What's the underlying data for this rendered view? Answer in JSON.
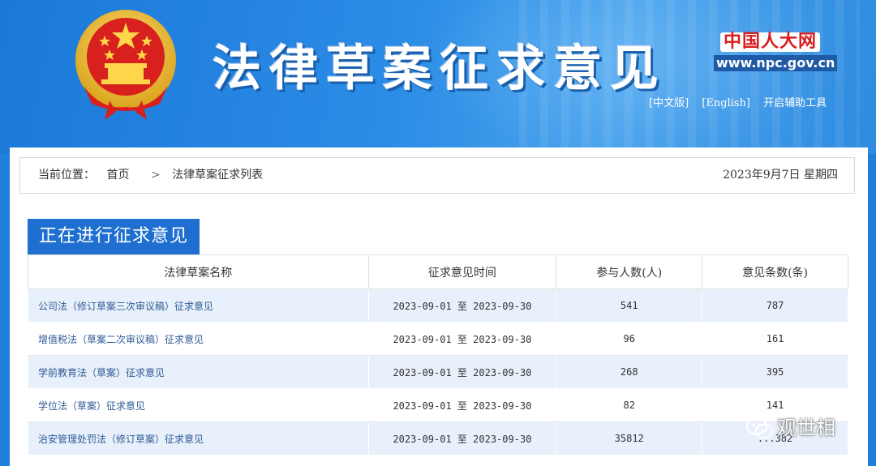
{
  "header": {
    "site_title": "法律草案征求意见",
    "npc_logo": "中国人大网",
    "npc_url": "www.npc.gov.cn",
    "links": [
      "[中文版]",
      "[English]",
      "开启辅助工具"
    ]
  },
  "breadcrumb": {
    "label": "当前位置：",
    "home": "首页",
    "current": "法律草案征求列表",
    "separator": ">",
    "date": "2023年9月7日 星期四"
  },
  "section": {
    "title": "正在进行征求意见"
  },
  "table": {
    "headers": [
      "法律草案名称",
      "征求意见时间",
      "参与人数(人)",
      "意见条数(条)"
    ],
    "rows": [
      {
        "name": "公司法（修订草案三次审议稿）征求意见",
        "period": "2023-09-01 至 2023-09-30",
        "participants": "541",
        "opinions": "787"
      },
      {
        "name": "增值税法（草案二次审议稿）征求意见",
        "period": "2023-09-01 至 2023-09-30",
        "participants": "96",
        "opinions": "161"
      },
      {
        "name": "学前教育法（草案）征求意见",
        "period": "2023-09-01 至 2023-09-30",
        "participants": "268",
        "opinions": "395"
      },
      {
        "name": "学位法（草案）征求意见",
        "period": "2023-09-01 至 2023-09-30",
        "participants": "82",
        "opinions": "141"
      },
      {
        "name": "治安管理处罚法（修订草案）征求意见",
        "period": "2023-09-01 至 2023-09-30",
        "participants": "35812",
        "opinions": "...382"
      }
    ]
  },
  "watermark": {
    "text": "观世相"
  },
  "colors": {
    "header_blue": "#1f7fd9",
    "section_blue": "#1f6fd0",
    "row_stripe": "#e8f0fb",
    "logo_red": "#d81e1e"
  }
}
